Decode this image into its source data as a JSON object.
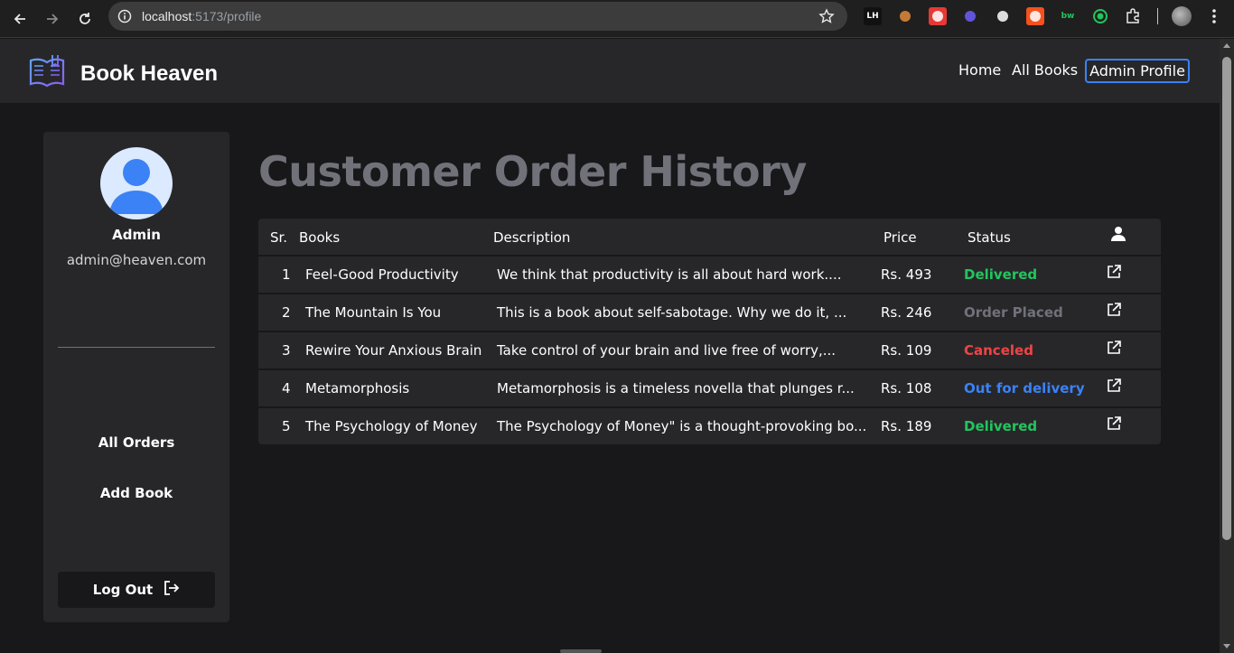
{
  "browser": {
    "url_host": "localhost",
    "url_path": ":5173/profile",
    "extensions": [
      {
        "icon": "lh-extension-icon",
        "text": "LH",
        "bg": "#111111",
        "fg": "#ffffff"
      },
      {
        "icon": "cookie-extension-icon",
        "text": "",
        "bg": "transparent",
        "fg": "#e28b3c"
      },
      {
        "icon": "red-extension-icon",
        "text": "",
        "bg": "#e53935",
        "fg": "#ffffff"
      },
      {
        "icon": "flame-extension-icon",
        "text": "",
        "bg": "transparent",
        "fg": "#6d5dfc"
      },
      {
        "icon": "eyedropper-extension-icon",
        "text": "",
        "bg": "transparent",
        "fg": "#ffffff"
      },
      {
        "icon": "orange-extension-icon",
        "text": "",
        "bg": "#f4511e",
        "fg": "#ffffff"
      },
      {
        "icon": "bw-extension-icon",
        "text": "bw",
        "bg": "transparent",
        "fg": "#22c55e"
      },
      {
        "icon": "target-extension-icon",
        "text": "",
        "bg": "transparent",
        "fg": "#22c55e"
      },
      {
        "icon": "puzzle-extensions-icon",
        "text": "",
        "bg": "transparent",
        "fg": "#ffffff"
      }
    ]
  },
  "header": {
    "brand": "Book Heaven",
    "nav": {
      "home": "Home",
      "all_books": "All Books",
      "profile": "Admin Profile"
    }
  },
  "sidebar": {
    "name": "Admin",
    "email": "admin@heaven.com",
    "links": {
      "all_orders": "All Orders",
      "add_book": "Add Book"
    },
    "logout": "Log Out"
  },
  "main": {
    "title": "Customer Order History",
    "columns": {
      "sr": "Sr.",
      "books": "Books",
      "description": "Description",
      "price": "Price",
      "status": "Status"
    },
    "orders": [
      {
        "sr": "1",
        "book": "Feel-Good Productivity",
        "description": "We think that productivity is all about hard work....",
        "price": "Rs. 493",
        "status": "Delivered"
      },
      {
        "sr": "2",
        "book": "The Mountain Is You",
        "description": "This is a book about self-sabotage. Why we do it, ...",
        "price": "Rs. 246",
        "status": "Order Placed"
      },
      {
        "sr": "3",
        "book": "Rewire Your Anxious Brain",
        "description": "Take control of your brain and live free of worry,...",
        "price": "Rs. 109",
        "status": "Canceled"
      },
      {
        "sr": "4",
        "book": "Metamorphosis",
        "description": "Metamorphosis is a timeless novella that plunges r...",
        "price": "Rs. 108",
        "status": "Out for delivery"
      },
      {
        "sr": "5",
        "book": "The Psychology of Money",
        "description": "The Psychology of Money\" is a thought-provoking bo...",
        "price": "Rs. 189",
        "status": "Delivered"
      }
    ]
  },
  "colors": {
    "delivered": "#22c55e",
    "order_placed": "#71717a",
    "canceled": "#ef4444",
    "out_for_delivery": "#3b82f6",
    "accent": "#3b82f6"
  }
}
